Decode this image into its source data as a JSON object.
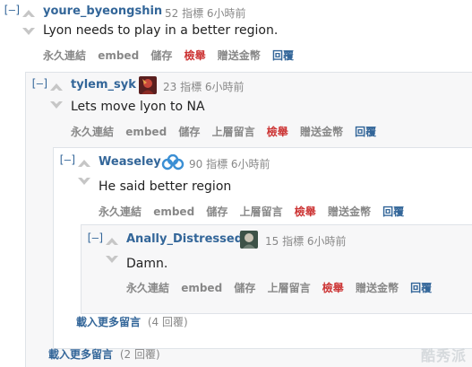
{
  "comments": [
    {
      "toggle": "[–]",
      "author": "youre_byeongshin",
      "points": "52 指標",
      "time": "6小時前",
      "body": "Lyon needs to play in a better region.",
      "actions": [
        "永久連結",
        "embed",
        "儲存",
        "檢舉",
        "贈送金幣",
        "回覆"
      ]
    },
    {
      "toggle": "[–]",
      "author": "tylem_syk",
      "points": "23 指標",
      "time": "6小時前",
      "body": "Lets move lyon to NA",
      "actions": [
        "永久連結",
        "embed",
        "儲存",
        "上層留言",
        "檢舉",
        "贈送金幣",
        "回覆"
      ]
    },
    {
      "toggle": "[–]",
      "author": "Weaseley",
      "points": "90 指標",
      "time": "6小時前",
      "body": "He said better region",
      "actions": [
        "永久連結",
        "embed",
        "儲存",
        "上層留言",
        "檢舉",
        "贈送金幣",
        "回覆"
      ]
    },
    {
      "toggle": "[–]",
      "author": "Anally_Distressed",
      "points": "15 指標",
      "time": "6小時前",
      "body": "Damn.",
      "actions": [
        "永久連結",
        "embed",
        "儲存",
        "上層留言",
        "檢舉",
        "贈送金幣",
        "回覆"
      ]
    }
  ],
  "load_more": [
    {
      "label": "載入更多留言",
      "count": "(4 回覆)"
    },
    {
      "label": "載入更多留言",
      "count": "(2 回覆)"
    }
  ],
  "watermark": "酷秀派",
  "colors": {
    "author": "#336699",
    "report": "#cc3333",
    "reply": "#336699",
    "muted": "#888888",
    "nested_bg": "#f7f7f8"
  }
}
